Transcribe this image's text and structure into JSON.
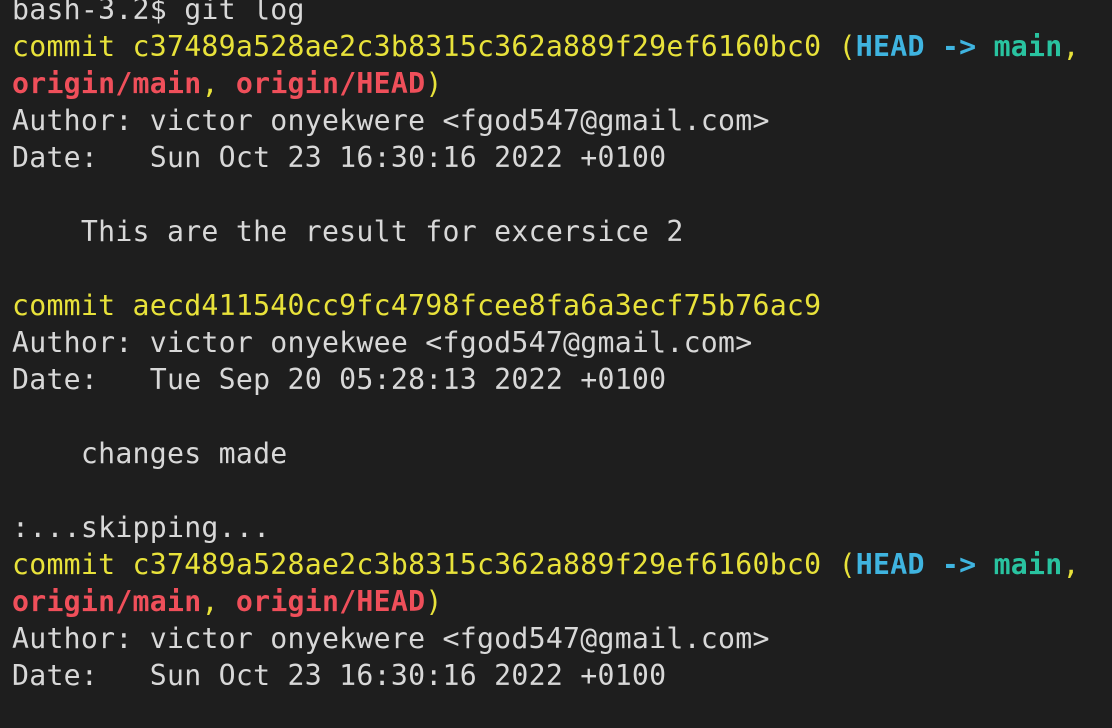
{
  "colors": {
    "background": "#1e1e1e",
    "text": "#d8d8d8",
    "commit": "#e8e23a",
    "head": "#3fb4e0",
    "branch_local": "#29c3a0",
    "branch_remote": "#ef4f5a"
  },
  "terminal": {
    "lines": [
      [
        {
          "text": "bash-3.2$ git log",
          "style": "plain"
        }
      ],
      [
        {
          "text": "commit c37489a528ae2c3b8315c362a889f29ef6160bc0 (",
          "style": "commit"
        },
        {
          "text": "HEAD -> ",
          "style": "head"
        },
        {
          "text": "main",
          "style": "main"
        },
        {
          "text": ",",
          "style": "commit"
        }
      ],
      [
        {
          "text": "origin/main",
          "style": "origin"
        },
        {
          "text": ", ",
          "style": "commit"
        },
        {
          "text": "origin/HEAD",
          "style": "origin"
        },
        {
          "text": ")",
          "style": "commit"
        }
      ],
      [
        {
          "text": "Author: victor onyekwere <fgod547@gmail.com>",
          "style": "plain"
        }
      ],
      [
        {
          "text": "Date:   Sun Oct 23 16:30:16 2022 +0100",
          "style": "plain"
        }
      ],
      [],
      [
        {
          "text": "    This are the result for excersice 2",
          "style": "plain"
        }
      ],
      [],
      [
        {
          "text": "commit aecd411540cc9fc4798fcee8fa6a3ecf75b76ac9",
          "style": "commit"
        }
      ],
      [
        {
          "text": "Author: victor onyekwee <fgod547@gmail.com>",
          "style": "plain"
        }
      ],
      [
        {
          "text": "Date:   Tue Sep 20 05:28:13 2022 +0100",
          "style": "plain"
        }
      ],
      [],
      [
        {
          "text": "    changes made",
          "style": "plain"
        }
      ],
      [],
      [
        {
          "text": ":...skipping...",
          "style": "plain"
        }
      ],
      [
        {
          "text": "commit c37489a528ae2c3b8315c362a889f29ef6160bc0 (",
          "style": "commit"
        },
        {
          "text": "HEAD -> ",
          "style": "head"
        },
        {
          "text": "main",
          "style": "main"
        },
        {
          "text": ",",
          "style": "commit"
        }
      ],
      [
        {
          "text": "origin/main",
          "style": "origin"
        },
        {
          "text": ", ",
          "style": "commit"
        },
        {
          "text": "origin/HEAD",
          "style": "origin"
        },
        {
          "text": ")",
          "style": "commit"
        }
      ],
      [
        {
          "text": "Author: victor onyekwere <fgod547@gmail.com>",
          "style": "plain"
        }
      ],
      [
        {
          "text": "Date:   Sun Oct 23 16:30:16 2022 +0100",
          "style": "plain"
        }
      ]
    ]
  }
}
